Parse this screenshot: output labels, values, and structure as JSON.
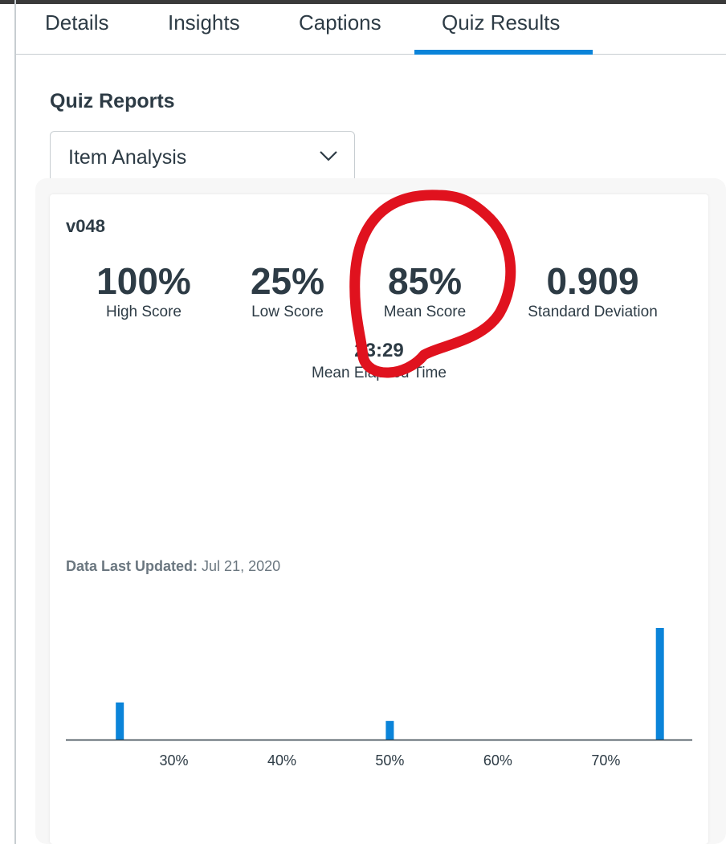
{
  "tabs": [
    {
      "label": "Details"
    },
    {
      "label": "Insights"
    },
    {
      "label": "Captions"
    },
    {
      "label": "Quiz Results",
      "active": true
    }
  ],
  "section_title": "Quiz Reports",
  "report_select": {
    "value": "Item Analysis",
    "icon": "chevron-down-icon"
  },
  "card": {
    "quiz_name": "v048",
    "stats": {
      "high": {
        "value": "100%",
        "label": "High Score"
      },
      "low": {
        "value": "25%",
        "label": "Low Score"
      },
      "mean": {
        "value": "85%",
        "label": "Mean Score"
      },
      "sd": {
        "value": "0.909",
        "label": "Standard Deviation"
      },
      "elapsed": {
        "value": "23:29",
        "label": "Mean Elapsed Time"
      }
    },
    "footer": {
      "label": "Data Last Updated:",
      "value": "Jul 21, 2020"
    }
  },
  "colors": {
    "accent": "#0b84d9",
    "text": "#2d3b45",
    "muted": "#6b7780",
    "annotation": "#e0121e"
  },
  "chart_data": {
    "type": "bar",
    "x_ticks": [
      "30%",
      "40%",
      "50%",
      "60%",
      "70%"
    ],
    "x_tick_values": [
      30,
      40,
      50,
      60,
      70
    ],
    "xlim": [
      20,
      78
    ],
    "ylim": [
      0,
      3
    ],
    "bars": [
      {
        "x": 25,
        "value": 1
      },
      {
        "x": 50,
        "value": 0.5
      },
      {
        "x": 75,
        "value": 3
      }
    ],
    "xlabel": "",
    "ylabel": "",
    "grid": false
  }
}
